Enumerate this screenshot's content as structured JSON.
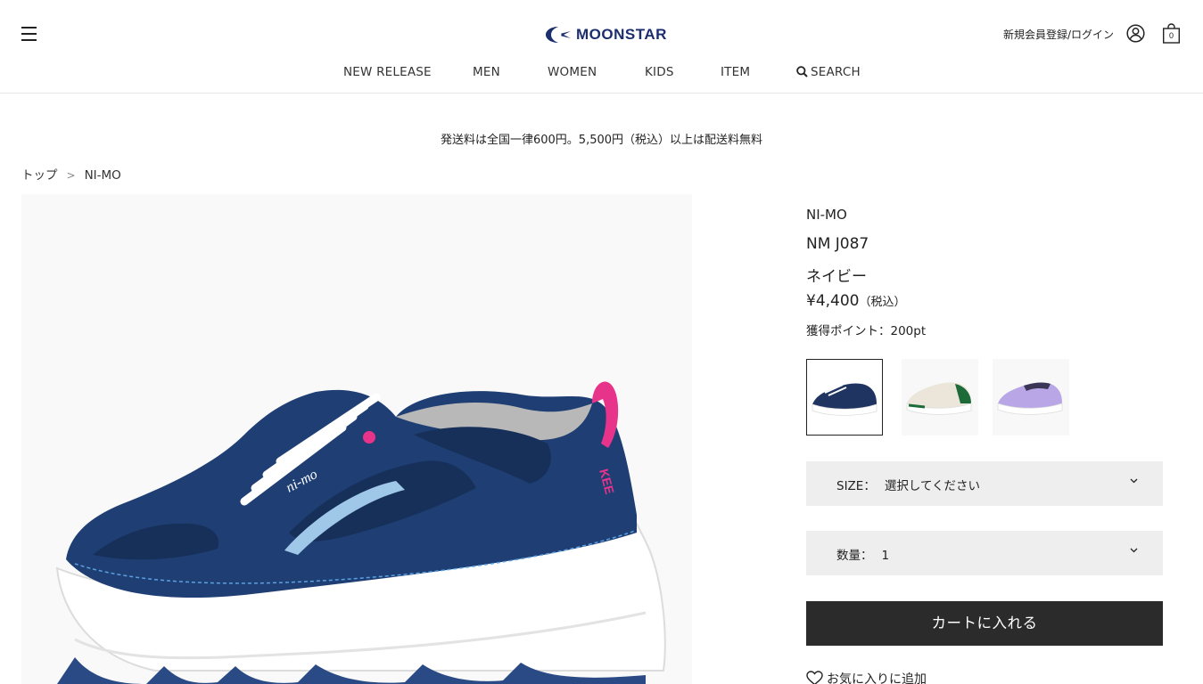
{
  "header": {
    "logo_text": "MOONSTAR",
    "login_label": "新規会員登録/ログイン",
    "cart_count": "0"
  },
  "nav": {
    "items": [
      {
        "label": "NEW RELEASE"
      },
      {
        "label": "MEN"
      },
      {
        "label": "WOMEN"
      },
      {
        "label": "KIDS"
      },
      {
        "label": "ITEM"
      },
      {
        "label": "SEARCH"
      }
    ]
  },
  "notice": "発送料は全国一律600円。5,500円（税込）以上は配送料無料",
  "breadcrumb": {
    "items": [
      {
        "label": "トップ"
      },
      {
        "label": "NI-MO"
      }
    ],
    "separator": ">"
  },
  "product": {
    "brand": "NI-MO",
    "model": "NM J087",
    "color_name": "ネイビー",
    "price": "¥4,400",
    "tax_label": "（税込）",
    "points": "獲得ポイント：200pt",
    "image_text": "ni-mo",
    "image_side_text": "KEE",
    "swatches": [
      {
        "color": "#1f3461",
        "accent": "#ffffff",
        "selected": true
      },
      {
        "color": "#ece6da",
        "accent": "#1e6b3a",
        "selected": false
      },
      {
        "color": "#b9a6e6",
        "accent": "#3b3556",
        "selected": false
      }
    ],
    "size_label": "SIZE：",
    "size_value": "選択してください",
    "qty_label": "数量：",
    "qty_value": "1",
    "cart_button": "カートに入れる",
    "favorite_label": "お気に入りに追加"
  },
  "colors": {
    "brand_blue": "#1b2e6e",
    "button_dark": "#2b2b2b",
    "select_bg": "#eeeeee",
    "shoe_navy": "#1f3f74",
    "accent_pink": "#e8338a"
  }
}
